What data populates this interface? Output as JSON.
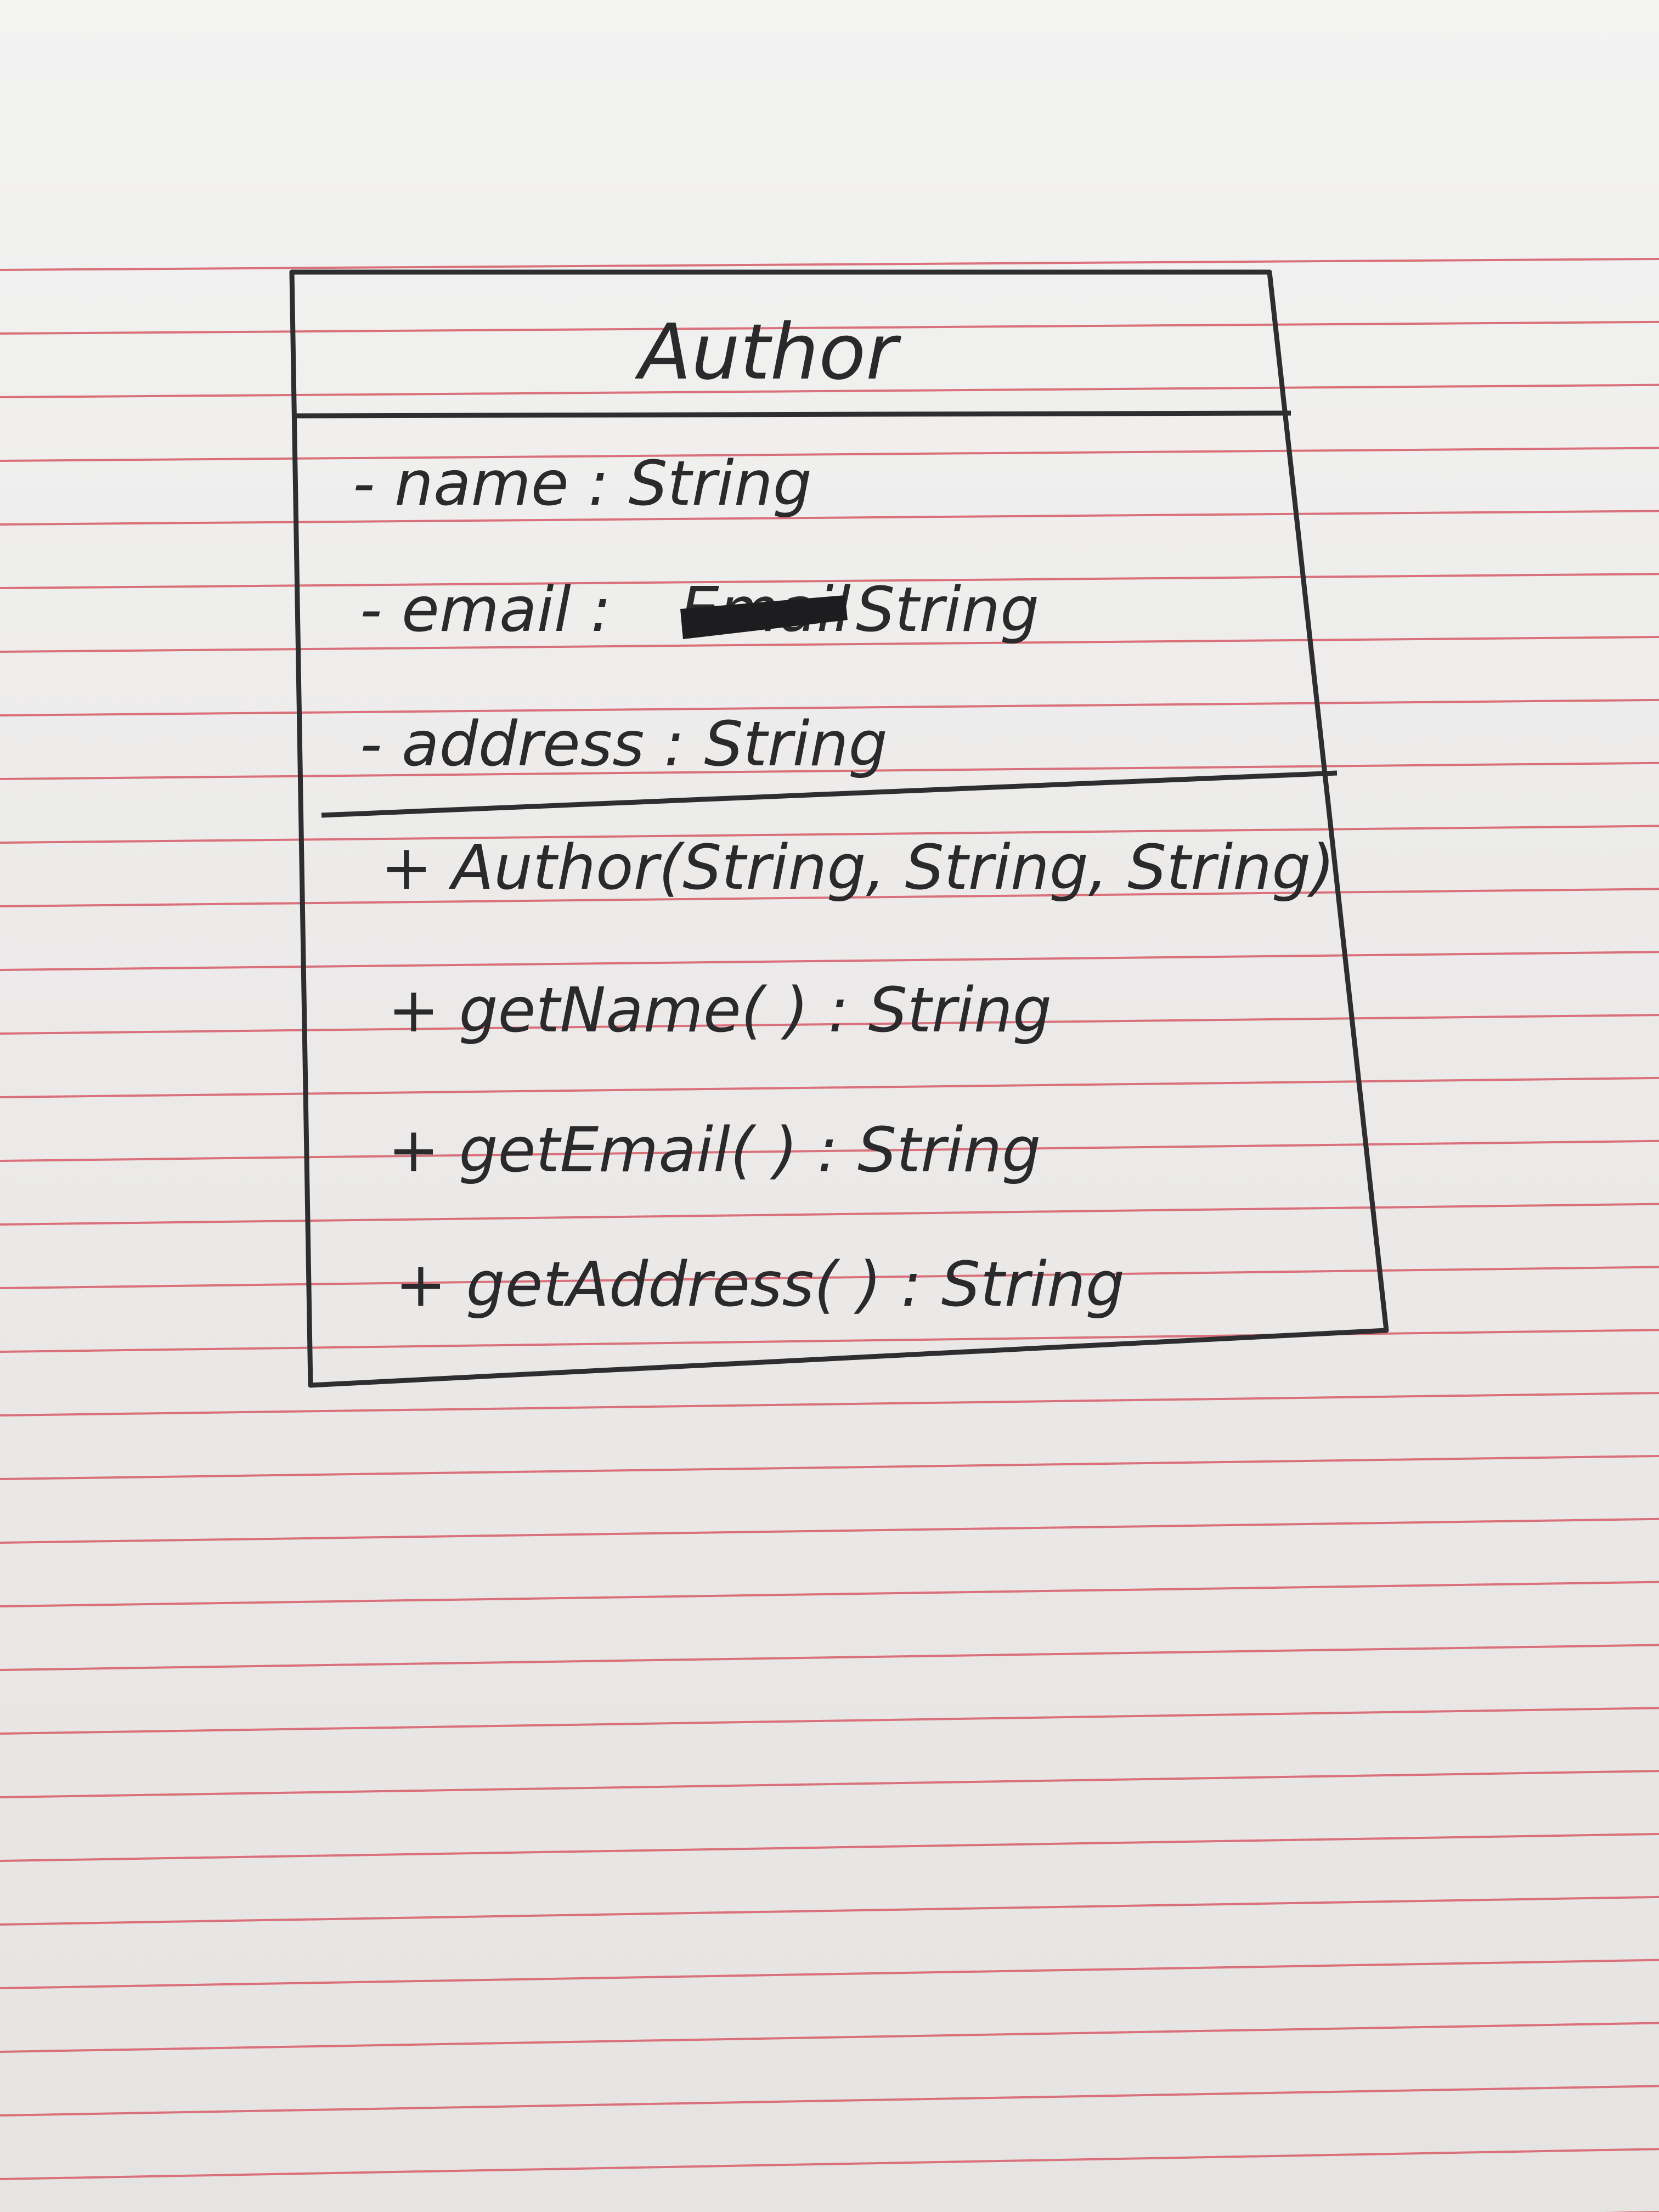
{
  "diagram": {
    "type": "uml-class",
    "class_name": "Author",
    "attributes": [
      {
        "visibility": "-",
        "name": "name",
        "type": "String",
        "text": "- name : String"
      },
      {
        "visibility": "-",
        "name": "email",
        "type": "String",
        "text": "- email : ",
        "crossed_out": "Email",
        "text_after": "String"
      },
      {
        "visibility": "-",
        "name": "address",
        "type": "String",
        "text": "- address : String"
      }
    ],
    "methods": [
      {
        "text": "+ Author(String, String, String)"
      },
      {
        "text": "+ getName( ) : String"
      },
      {
        "text": "+ getEmail( ) : String"
      },
      {
        "text": "+ getAddress( ) : String"
      }
    ]
  },
  "colors": {
    "ink": "#2a2a2c",
    "rule": "#d9707a",
    "paper": "#ecebea"
  }
}
